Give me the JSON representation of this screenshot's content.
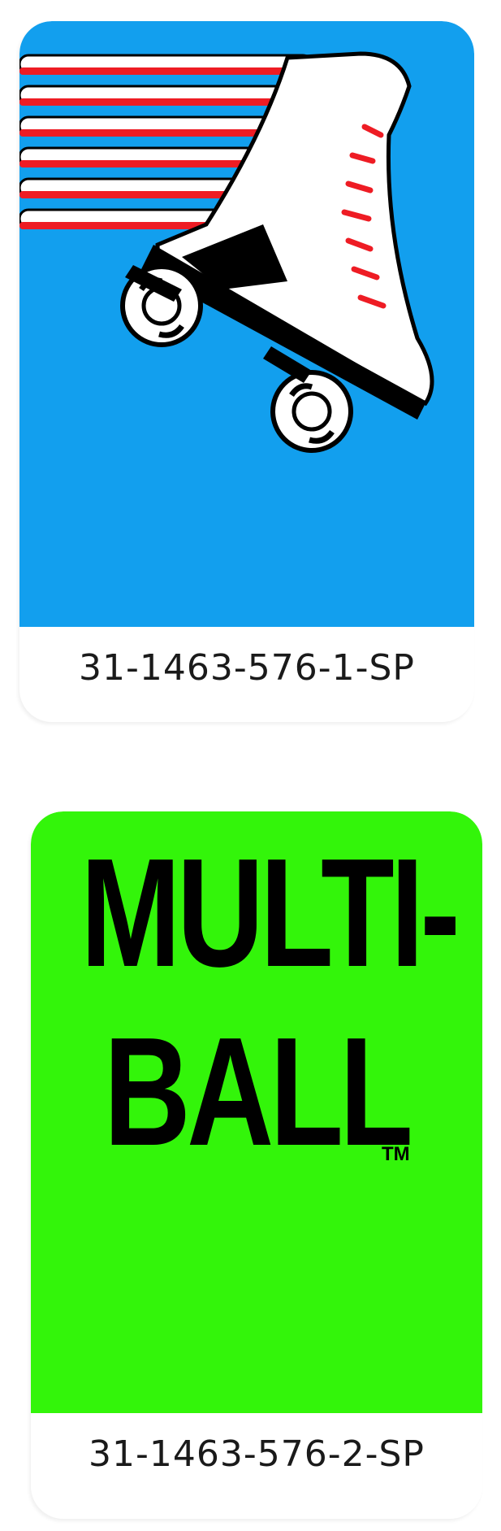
{
  "labels": [
    {
      "part_number": "31-1463-576-1-SP",
      "panel_color": "#129fee",
      "art": "roller-skate-icon"
    },
    {
      "title_line1": "MULTI-",
      "title_line2": "BALL",
      "trademark": "TM",
      "part_number": "31-1463-576-2-SP",
      "panel_color": "#33f50a"
    }
  ],
  "colors": {
    "stripe_red": "#ee1c24",
    "stripe_white": "#ffffff",
    "outline": "#000000"
  }
}
